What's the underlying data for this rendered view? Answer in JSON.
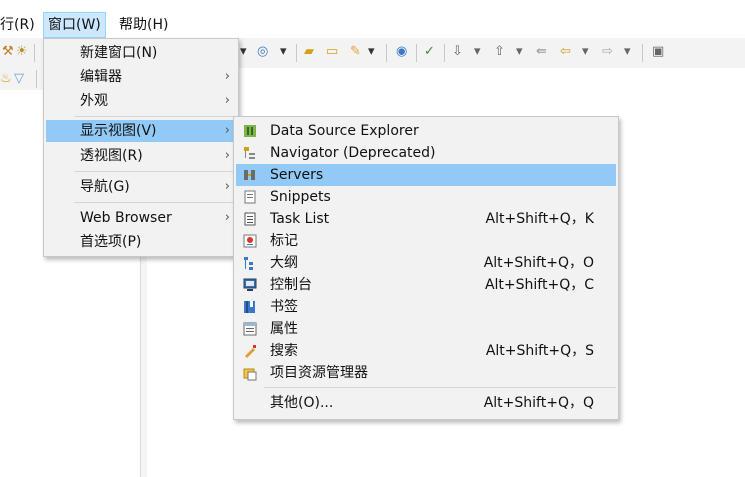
{
  "menubar": {
    "run": "行(R)",
    "window": "窗口(W)",
    "help": "帮助(H)"
  },
  "window_menu": {
    "items": [
      {
        "label": "新建窗口(N)",
        "submenu": false
      },
      {
        "label": "编辑器",
        "submenu": true
      },
      {
        "label": "外观",
        "submenu": true
      },
      {
        "label": "显示视图(V)",
        "submenu": true,
        "selected": true
      },
      {
        "label": "透视图(R)",
        "submenu": true
      },
      {
        "label": "导航(G)",
        "submenu": true
      },
      {
        "label": "Web Browser",
        "submenu": true
      },
      {
        "label": "首选项(P)",
        "submenu": false
      }
    ]
  },
  "show_view_menu": {
    "items": [
      {
        "label": "Data Source Explorer",
        "accel": "",
        "icon": "data-source-icon"
      },
      {
        "label": "Navigator (Deprecated)",
        "accel": "",
        "icon": "navigator-icon"
      },
      {
        "label": "Servers",
        "accel": "",
        "icon": "servers-icon",
        "selected": true
      },
      {
        "label": "Snippets",
        "accel": "",
        "icon": "snippets-icon"
      },
      {
        "label": "Task List",
        "accel": "Alt+Shift+Q，K",
        "icon": "task-list-icon"
      },
      {
        "label": "标记",
        "accel": "",
        "icon": "markers-icon"
      },
      {
        "label": "大纲",
        "accel": "Alt+Shift+Q，O",
        "icon": "outline-icon"
      },
      {
        "label": "控制台",
        "accel": "Alt+Shift+Q，C",
        "icon": "console-icon"
      },
      {
        "label": "书签",
        "accel": "",
        "icon": "bookmarks-icon"
      },
      {
        "label": "属性",
        "accel": "",
        "icon": "properties-icon"
      },
      {
        "label": "搜索",
        "accel": "Alt+Shift+Q，S",
        "icon": "search-icon"
      },
      {
        "label": "项目资源管理器",
        "accel": "",
        "icon": "project-explorer-icon"
      },
      {
        "label": "其他(O)...",
        "accel": "Alt+Shift+Q，Q",
        "icon": ""
      }
    ]
  },
  "colors": {
    "selection": "#91c9f7",
    "menubar_active": "#cce8ff",
    "menu_bg": "#f2f2f2"
  }
}
